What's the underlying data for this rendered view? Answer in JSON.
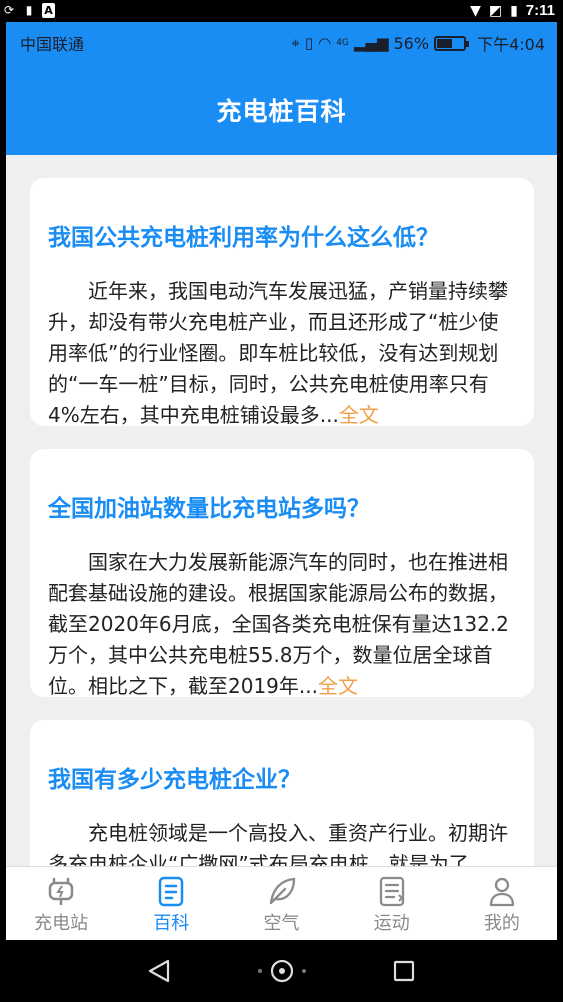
{
  "system_bar": {
    "time": "7:11",
    "left_icons": [
      "sync-icon",
      "sd-card-icon",
      "font-icon"
    ],
    "right_icons": [
      "wifi-icon",
      "no-sim-icon",
      "battery-charging-icon"
    ]
  },
  "inner_status": {
    "carrier": "中国联通",
    "network": "4G",
    "battery_percent": "56%",
    "battery_level": 0.56,
    "time": "下午4:04"
  },
  "header": {
    "title": "充电桩百科"
  },
  "articles": [
    {
      "title": "我国公共充电桩利用率为什么这么低？",
      "summary": "近年来，我国电动汽车发展迅猛，产销量持续攀升，却没有带火充电桩产业，而且还形成了“桩少使用率低”的行业怪圈。即车桩比较低，没有达到规划的“一车一桩”目标，同时，公共充电桩使用率只有4%左右，其中充电桩铺设最多...",
      "more": "全文"
    },
    {
      "title": "全国加油站数量比充电站多吗？",
      "summary": "国家在大力发展新能源汽车的同时，也在推进相配套基础设施的建设。根据国家能源局公布的数据，截至2020年6月底，全国各类充电桩保有量达132.2万个，其中公共充电桩55.8万个，数量位居全球首位。相比之下，截至2019年...",
      "more": "全文"
    },
    {
      "title": "我国有多少充电桩企业？",
      "summary": "充电桩领域是一个高投入、重资产行业。初期许多充电桩企业“广撒网”式布局充电桩，就是为了",
      "more": ""
    }
  ],
  "tabs": [
    {
      "label": "充电站",
      "icon": "charging-station-icon",
      "active": false
    },
    {
      "label": "百科",
      "icon": "document-icon",
      "active": true
    },
    {
      "label": "空气",
      "icon": "leaf-icon",
      "active": false
    },
    {
      "label": "运动",
      "icon": "notes-icon",
      "active": false
    },
    {
      "label": "我的",
      "icon": "user-icon",
      "active": false
    }
  ],
  "colors": {
    "accent": "#1a8df5",
    "more_link": "#f0a04a",
    "inactive_tab": "#8a8a8a",
    "background": "#efefef"
  }
}
